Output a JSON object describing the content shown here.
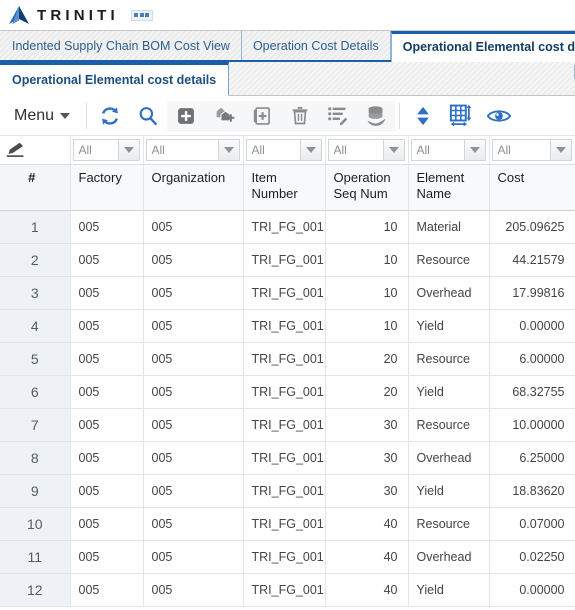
{
  "header": {
    "logo_text": "TRINITI",
    "logo_icon": "triangle-logo-icon",
    "menu_toggle_icon": "grid-menu-icon"
  },
  "tabs": [
    {
      "label": "Indented Supply Chain BOM Cost View",
      "active": false
    },
    {
      "label": "Operation Cost Details",
      "active": false
    },
    {
      "label": "Operational Elemental cost de",
      "active": true
    }
  ],
  "subtabs": [
    {
      "label": "Operational Elemental cost details",
      "active": true
    }
  ],
  "toolbar": {
    "menu_label": "Menu",
    "buttons": [
      {
        "name": "refresh-icon",
        "title": "Refresh"
      },
      {
        "name": "search-icon",
        "title": "Search"
      },
      {
        "name": "add-icon",
        "title": "Add"
      },
      {
        "name": "duplicate-icon",
        "title": "Duplicate"
      },
      {
        "name": "insert-row-icon",
        "title": "Insert"
      },
      {
        "name": "delete-icon",
        "title": "Delete"
      },
      {
        "name": "edit-list-icon",
        "title": "Edit List"
      },
      {
        "name": "database-icon",
        "title": "Data"
      },
      {
        "name": "sort-icon",
        "title": "Sort"
      },
      {
        "name": "resize-grid-icon",
        "title": "Resize Grid"
      },
      {
        "name": "view-icon",
        "title": "View"
      }
    ]
  },
  "grid": {
    "filter_pencil_icon": "pencil-icon",
    "filters": [
      {
        "value": "All"
      },
      {
        "value": "All"
      },
      {
        "value": "All"
      },
      {
        "value": "All"
      },
      {
        "value": "All"
      },
      {
        "value": "All"
      }
    ],
    "columns": [
      {
        "key": "num",
        "label": "#"
      },
      {
        "key": "factory",
        "label": "Factory"
      },
      {
        "key": "organization",
        "label": "Organization"
      },
      {
        "key": "item_number",
        "label": "Item Number"
      },
      {
        "key": "operation_seq_num",
        "label": "Operation Seq Num"
      },
      {
        "key": "element_name",
        "label": "Element Name"
      },
      {
        "key": "cost",
        "label": "Cost"
      }
    ],
    "rows": [
      {
        "num": "1",
        "factory": "005",
        "organization": "005",
        "item_number": "TRI_FG_001",
        "operation_seq_num": "10",
        "element_name": "Material",
        "cost": "205.09625"
      },
      {
        "num": "2",
        "factory": "005",
        "organization": "005",
        "item_number": "TRI_FG_001",
        "operation_seq_num": "10",
        "element_name": "Resource",
        "cost": "44.21579"
      },
      {
        "num": "3",
        "factory": "005",
        "organization": "005",
        "item_number": "TRI_FG_001",
        "operation_seq_num": "10",
        "element_name": "Overhead",
        "cost": "17.99816"
      },
      {
        "num": "4",
        "factory": "005",
        "organization": "005",
        "item_number": "TRI_FG_001",
        "operation_seq_num": "10",
        "element_name": "Yield",
        "cost": "0.00000"
      },
      {
        "num": "5",
        "factory": "005",
        "organization": "005",
        "item_number": "TRI_FG_001",
        "operation_seq_num": "20",
        "element_name": "Resource",
        "cost": "6.00000"
      },
      {
        "num": "6",
        "factory": "005",
        "organization": "005",
        "item_number": "TRI_FG_001",
        "operation_seq_num": "20",
        "element_name": "Yield",
        "cost": "68.32755"
      },
      {
        "num": "7",
        "factory": "005",
        "organization": "005",
        "item_number": "TRI_FG_001",
        "operation_seq_num": "30",
        "element_name": "Resource",
        "cost": "10.00000"
      },
      {
        "num": "8",
        "factory": "005",
        "organization": "005",
        "item_number": "TRI_FG_001",
        "operation_seq_num": "30",
        "element_name": "Overhead",
        "cost": "6.25000"
      },
      {
        "num": "9",
        "factory": "005",
        "organization": "005",
        "item_number": "TRI_FG_001",
        "operation_seq_num": "30",
        "element_name": "Yield",
        "cost": "18.83620"
      },
      {
        "num": "10",
        "factory": "005",
        "organization": "005",
        "item_number": "TRI_FG_001",
        "operation_seq_num": "40",
        "element_name": "Resource",
        "cost": "0.07000"
      },
      {
        "num": "11",
        "factory": "005",
        "organization": "005",
        "item_number": "TRI_FG_001",
        "operation_seq_num": "40",
        "element_name": "Overhead",
        "cost": "0.02250"
      },
      {
        "num": "12",
        "factory": "005",
        "organization": "005",
        "item_number": "TRI_FG_001",
        "operation_seq_num": "40",
        "element_name": "Yield",
        "cost": "0.00000"
      }
    ]
  },
  "colors": {
    "accent_blue": "#1b5fa8",
    "icon_blue": "#2f6fc4",
    "icon_gray": "#8d8d8d",
    "row_num_bg": "#eef2f7"
  }
}
